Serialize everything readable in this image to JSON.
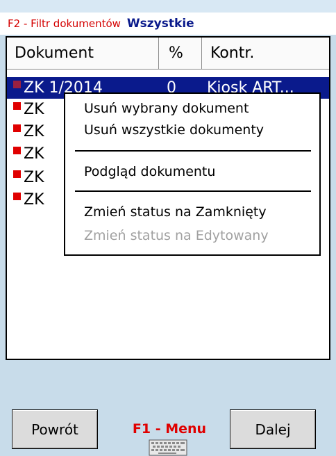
{
  "filter": {
    "label": "F2 - Filtr dokumentów",
    "value": "Wszystkie"
  },
  "table": {
    "columns": [
      "Dokument",
      "%",
      "Kontr."
    ],
    "rows": [
      {
        "doc": "ZK 1/2014",
        "pct": "0",
        "contr": "Kiosk ART...",
        "selected": true
      },
      {
        "doc": "ZK",
        "pct": "",
        "contr": "",
        "selected": false
      },
      {
        "doc": "ZK",
        "pct": "",
        "contr": "",
        "selected": false
      },
      {
        "doc": "ZK",
        "pct": "",
        "contr": "",
        "selected": false
      },
      {
        "doc": "ZK",
        "pct": "",
        "contr": "",
        "selected": false
      },
      {
        "doc": "ZK",
        "pct": "",
        "contr": "",
        "selected": false
      }
    ]
  },
  "context_menu": {
    "items": [
      {
        "label": "Usuń wybrany dokument",
        "enabled": true
      },
      {
        "label": "Usuń wszystkie dokumenty",
        "enabled": true
      },
      {
        "label": "Podgląd dokumentu",
        "enabled": true
      },
      {
        "label": "Zmień status na Zamknięty",
        "enabled": true
      },
      {
        "label": "Zmień status na Edytowany",
        "enabled": false
      }
    ]
  },
  "footer": {
    "back_label": "Powrót",
    "menu_label": "F1 - Menu",
    "next_label": "Dalej",
    "keyboard_icon": "keyboard-icon"
  },
  "colors": {
    "accent_red": "#e00000",
    "selection_blue": "#0a1a8c",
    "background": "#c8dcea"
  }
}
